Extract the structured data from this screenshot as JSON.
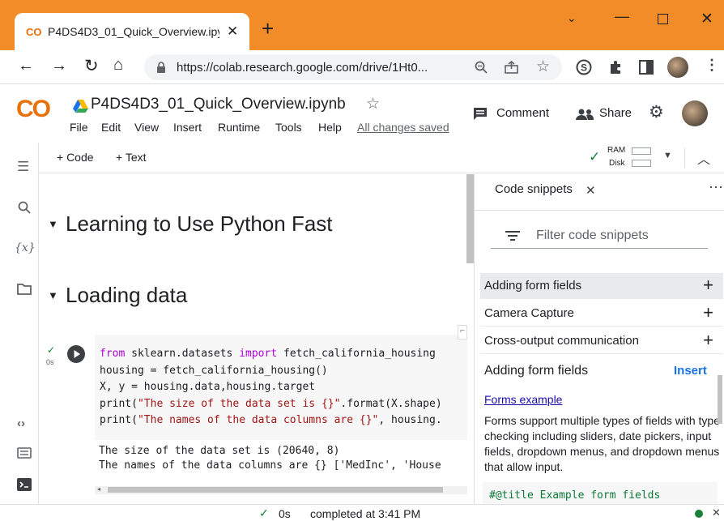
{
  "browser": {
    "tab_title": "P4DS4D3_01_Quick_Overview.ipyr",
    "url": "https://colab.research.google.com/drive/1Ht0...",
    "accent": "#f28c28"
  },
  "colab": {
    "logo_text": "CO",
    "notebook_title": "P4DS4D3_01_Quick_Overview.ipynb",
    "menu": [
      "File",
      "Edit",
      "View",
      "Insert",
      "Runtime",
      "Tools",
      "Help"
    ],
    "save_status": "All changes saved",
    "comment_label": "Comment",
    "share_label": "Share"
  },
  "toolbar": {
    "add_code": "+ Code",
    "add_text": "+ Text",
    "ram_label": "RAM",
    "disk_label": "Disk"
  },
  "notebook": {
    "headings": [
      "Learning to Use Python Fast",
      "Loading data"
    ],
    "cell_exec_time": "0s",
    "output": [
      "The size of the data set is (20640, 8)",
      "The names of the data columns are {} ['MedInc', 'House"
    ]
  },
  "side_panel": {
    "tab_label": "Code snippets",
    "filter_placeholder": "Filter code snippets",
    "snippets": [
      "Adding form fields",
      "Camera Capture",
      "Cross-output communication"
    ],
    "selected_title": "Adding form fields",
    "insert_label": "Insert",
    "link_text": "Forms example",
    "description": "Forms support multiple types of fields with type checking including sliders, date pickers, input fields, dropdown menus, and dropdown menus that allow input.",
    "code_preview": "#@title Example form fields"
  },
  "status": {
    "elapsed": "0s",
    "message": "completed at 3:41 PM"
  }
}
